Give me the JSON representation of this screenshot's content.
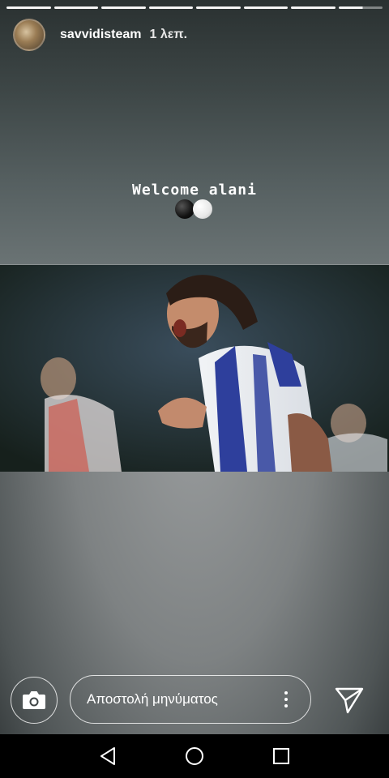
{
  "story": {
    "segments_total": 8,
    "username": "savvidisteam",
    "time": "1 λεπ.",
    "caption": "Welcome alani"
  },
  "reply": {
    "placeholder": "Αποστολή μηνύματος"
  },
  "icons": {
    "camera": "camera-icon",
    "more": "more-vertical-icon",
    "send": "send-icon",
    "back": "nav-back-icon",
    "home": "nav-home-icon",
    "recents": "nav-recents-icon"
  }
}
